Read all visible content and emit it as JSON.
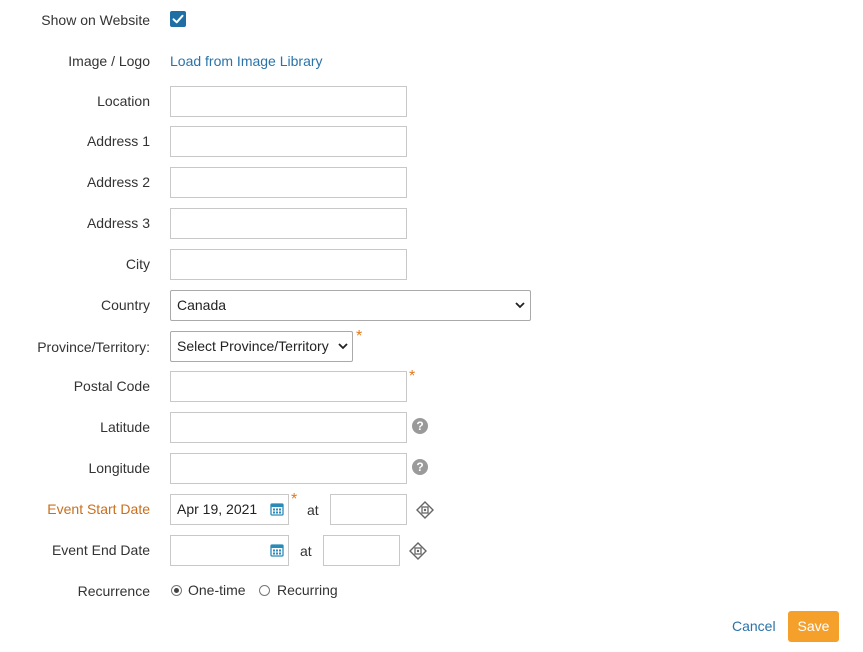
{
  "form": {
    "show_on_website": {
      "label": "Show on Website",
      "checked": true
    },
    "image_logo": {
      "label": "Image / Logo",
      "link": "Load from Image Library"
    },
    "location": {
      "label": "Location",
      "value": ""
    },
    "address1": {
      "label": "Address 1",
      "value": ""
    },
    "address2": {
      "label": "Address 2",
      "value": ""
    },
    "address3": {
      "label": "Address 3",
      "value": ""
    },
    "city": {
      "label": "City",
      "value": ""
    },
    "country": {
      "label": "Country",
      "selected": "Canada"
    },
    "province": {
      "label": "Province/Territory:",
      "selected": "Select Province/Territory"
    },
    "postal_code": {
      "label": "Postal Code",
      "value": ""
    },
    "latitude": {
      "label": "Latitude",
      "value": ""
    },
    "longitude": {
      "label": "Longitude",
      "value": ""
    },
    "event_start": {
      "label": "Event Start Date",
      "date": "Apr 19, 2021",
      "at": "at",
      "time": ""
    },
    "event_end": {
      "label": "Event End Date",
      "date": "",
      "at": "at",
      "time": ""
    },
    "recurrence": {
      "label": "Recurrence",
      "options": [
        "One-time",
        "Recurring"
      ],
      "selected": "One-time"
    }
  },
  "required_marker": "*",
  "help_glyph": "?",
  "actions": {
    "cancel": "Cancel",
    "save": "Save"
  },
  "colors": {
    "accent_link": "#2a73a8",
    "save_button": "#f5a02b",
    "required": "#e07a1f",
    "highlight_label": "#c86f1e"
  }
}
